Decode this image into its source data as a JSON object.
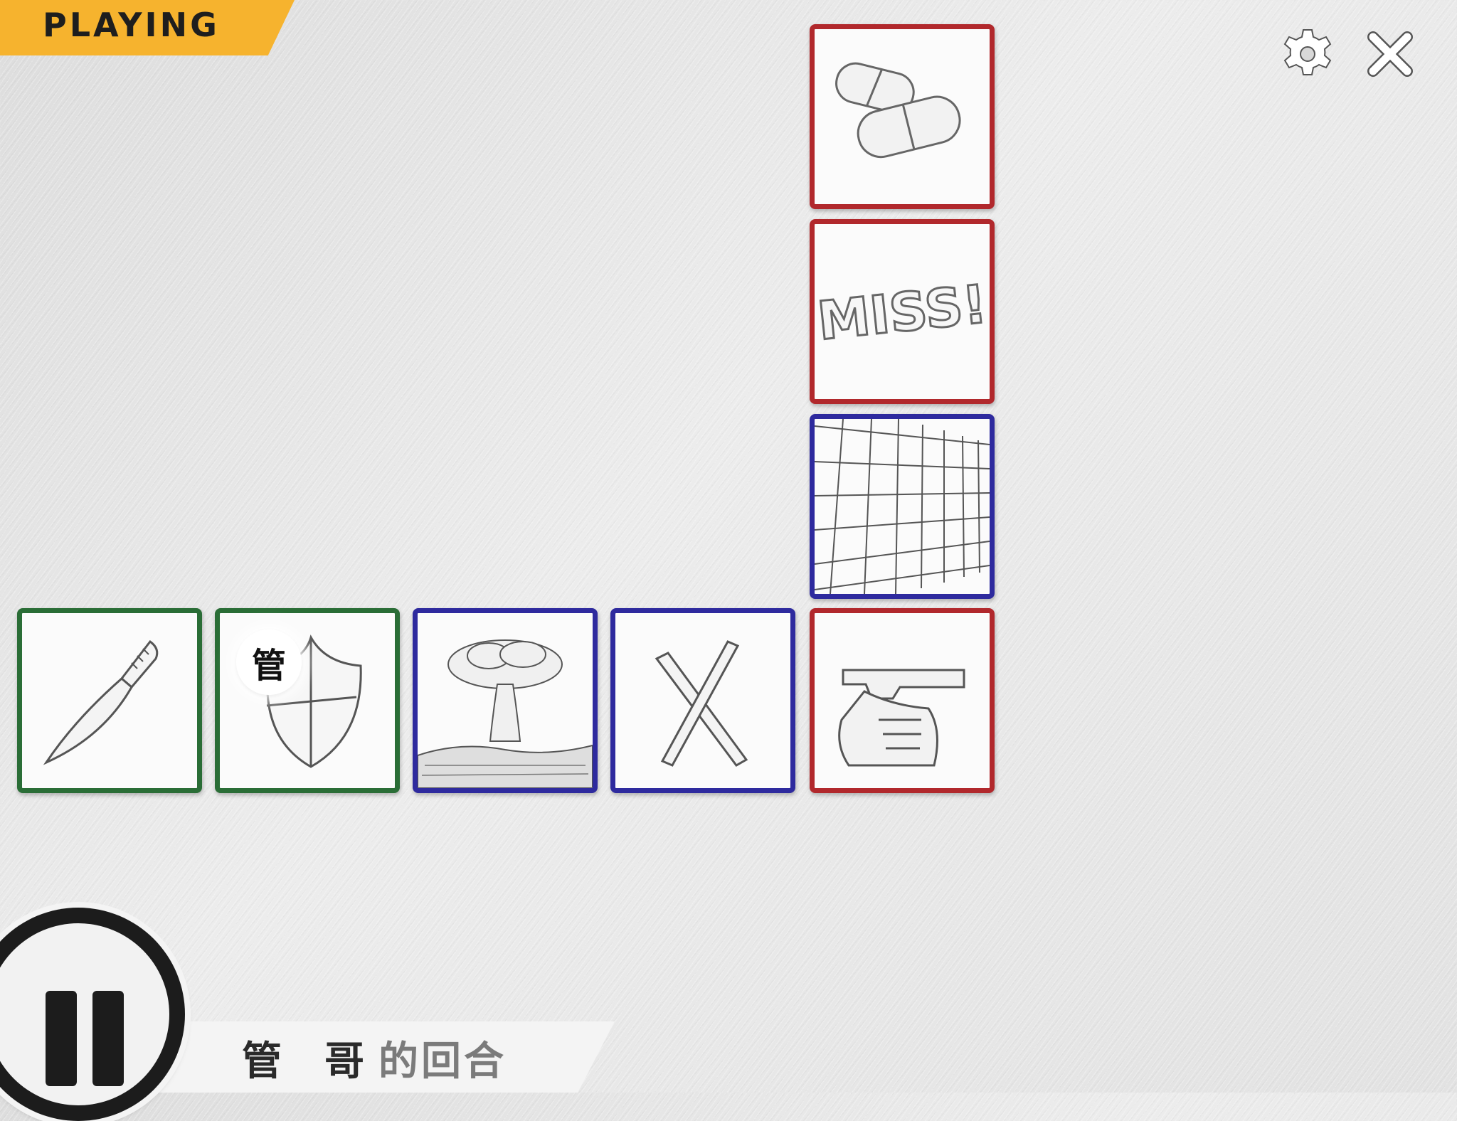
{
  "status": {
    "label": "PLAYING"
  },
  "toolbar": {
    "settings_icon": "gear-icon",
    "close_icon": "close-icon"
  },
  "board": {
    "tiles": [
      {
        "id": "pills",
        "icon": "pills-icon",
        "border": "red"
      },
      {
        "id": "miss",
        "icon": "miss-text-icon",
        "text": "MISS!",
        "border": "red"
      },
      {
        "id": "grid",
        "icon": "grid-wall-icon",
        "border": "blue"
      },
      {
        "id": "knife",
        "icon": "knife-icon",
        "border": "green"
      },
      {
        "id": "shield",
        "icon": "shield-icon",
        "border": "green"
      },
      {
        "id": "explosion",
        "icon": "mushroom-cloud-icon",
        "border": "blue"
      },
      {
        "id": "cross",
        "icon": "x-mark-icon",
        "border": "blue"
      },
      {
        "id": "gun",
        "icon": "pistol-icon",
        "border": "red"
      }
    ],
    "player_marker": "管"
  },
  "turn": {
    "player_name": "管哥",
    "suffix": "的回合"
  },
  "controls": {
    "pause_icon": "pause-icon"
  },
  "colors": {
    "red": "#b1282c",
    "blue": "#2e2a9e",
    "green": "#2a6d36",
    "accent": "#f6b32e"
  }
}
